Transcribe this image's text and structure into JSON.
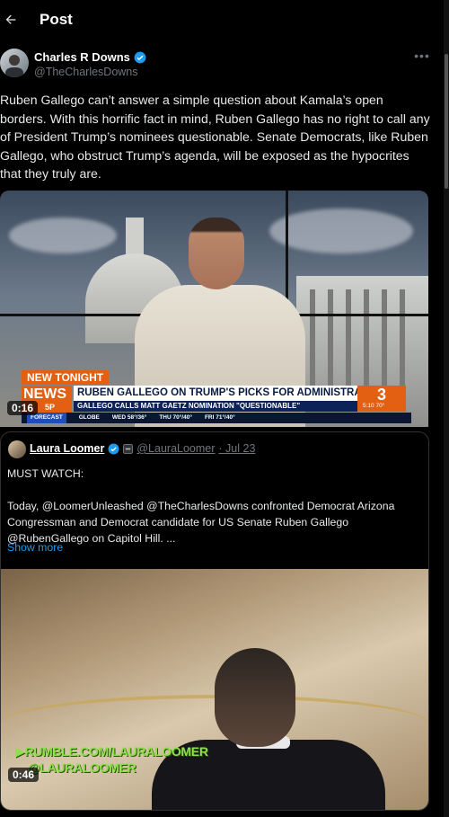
{
  "header": {
    "title": "Post",
    "back_icon": "arrow-left-icon"
  },
  "author": {
    "name": "Charles R Downs",
    "handle": "@TheCharlesDowns",
    "verified_color": "#1d9bf0"
  },
  "tweet": {
    "text": "Ruben Gallego can’t answer a simple question about Kamala’s open borders. With this horrific fact in mind, Ruben Gallego has no right to call any of President Trump’s nominees questionable. Senate Democrats, like Ruben Gallego, who obstruct Trump’s agenda, will be exposed as the hypocrites that they truly are."
  },
  "video1": {
    "duration": "0:16",
    "tag": "NEW TONIGHT",
    "news_logo": "NEWS",
    "news_time": "5P",
    "headline": "RUBEN GALLEGO ON TRUMP'S PICKS FOR ADMINISTRATION",
    "subheadline": "GALLEGO CALLS MATT GAETZ NOMINATION \"QUESTIONABLE\"",
    "channel": "3",
    "channel_meta": "5:10   70°",
    "forecast": [
      "FORECAST",
      "GLOBE",
      "WED 58°/36°",
      "THU 70°/40°",
      "FRI 71°/40°"
    ]
  },
  "quote": {
    "name": "Laura Loomer",
    "handle": "@LauraLoomer",
    "date": "· Jul 23",
    "line1": "MUST WATCH:",
    "line2": "Today, @LoomerUnleashed @TheCharlesDowns confronted Democrat Arizona Congressman and Democrat candidate for US Senate Ruben Gallego @RubenGallego on Capitol Hill.  ...",
    "show_more": "Show more",
    "video": {
      "duration": "0:46",
      "watermark1": "RUMBLE.COM/LAURALOOMER",
      "watermark2": "@LAURALOOMER"
    }
  },
  "colors": {
    "accent": "#1d9bf0",
    "background": "#000000",
    "muted": "#71767b",
    "news_orange": "#e35f12"
  }
}
